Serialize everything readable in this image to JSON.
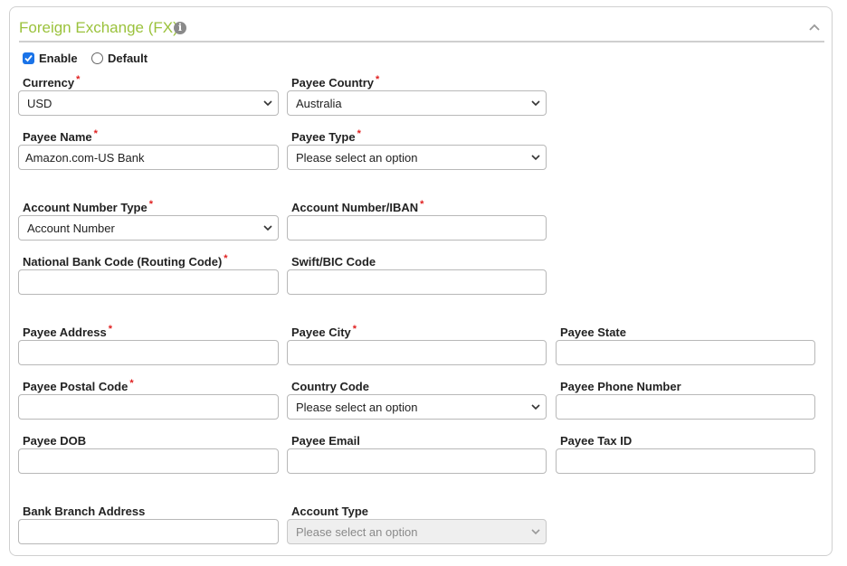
{
  "section": {
    "title": "Foreign Exchange (FX)",
    "info_icon": "i"
  },
  "options": {
    "enable_label": "Enable",
    "enable_checked": true,
    "default_label": "Default",
    "default_checked": false
  },
  "fields": {
    "currency": {
      "label": "Currency",
      "required": true,
      "value": "USD"
    },
    "payee_country": {
      "label": "Payee Country",
      "required": true,
      "value": "Australia"
    },
    "payee_name": {
      "label": "Payee Name",
      "required": true,
      "value": "Amazon.com-US Bank"
    },
    "payee_type": {
      "label": "Payee Type",
      "required": true,
      "value": "Please select an option"
    },
    "account_number_type": {
      "label": "Account Number Type",
      "required": true,
      "value": "Account Number"
    },
    "account_number_iban": {
      "label": "Account Number/IBAN",
      "required": true,
      "value": ""
    },
    "national_bank_code": {
      "label": "National Bank Code (Routing Code)",
      "required": true,
      "value": ""
    },
    "swift_bic": {
      "label": "Swift/BIC Code",
      "required": false,
      "value": ""
    },
    "payee_address": {
      "label": "Payee Address",
      "required": true,
      "value": ""
    },
    "payee_city": {
      "label": "Payee City",
      "required": true,
      "value": ""
    },
    "payee_state": {
      "label": "Payee State",
      "required": false,
      "value": ""
    },
    "payee_postal_code": {
      "label": "Payee Postal Code",
      "required": true,
      "value": ""
    },
    "country_code": {
      "label": "Country Code",
      "required": false,
      "value": "Please select an option"
    },
    "payee_phone": {
      "label": "Payee Phone Number",
      "required": false,
      "value": ""
    },
    "payee_dob": {
      "label": "Payee DOB",
      "required": false,
      "value": ""
    },
    "payee_email": {
      "label": "Payee Email",
      "required": false,
      "value": ""
    },
    "payee_tax_id": {
      "label": "Payee Tax ID",
      "required": false,
      "value": ""
    },
    "bank_branch_address": {
      "label": "Bank Branch Address",
      "required": false,
      "value": ""
    },
    "account_type": {
      "label": "Account Type",
      "required": false,
      "value": "Please select an option",
      "disabled": true
    }
  },
  "required_marker": "*",
  "colors": {
    "accent": "#9bc23c",
    "required": "#e02020",
    "checkbox": "#1a73e8"
  }
}
